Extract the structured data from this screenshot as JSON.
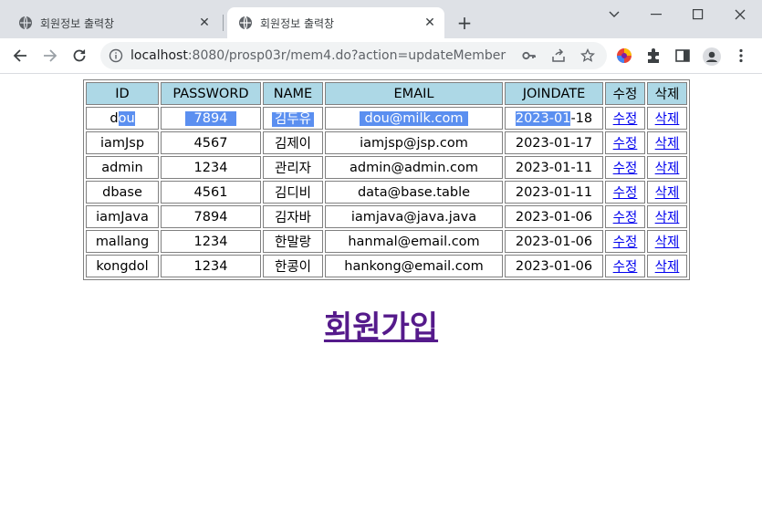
{
  "browser": {
    "tabs": [
      {
        "title": "회원정보 출력창",
        "active": false
      },
      {
        "title": "회원정보 출력창",
        "active": true
      }
    ],
    "url_host": "localhost",
    "url_rest": ":8080/prosp03r/mem4.do?action=updateMember"
  },
  "table": {
    "headers": {
      "id": "ID",
      "password": "PASSWORD",
      "name": "NAME",
      "email": "EMAIL",
      "joindate": "JOINDATE",
      "edit": "수정",
      "delete": "삭제"
    },
    "rows": [
      {
        "id": "dou",
        "password": "7894",
        "name": "김두유",
        "email": "dou@milk.com",
        "joindate": "2023-01-18",
        "edit": "수정",
        "delete": "삭제"
      },
      {
        "id": "iamJsp",
        "password": "4567",
        "name": "김제이",
        "email": "iamjsp@jsp.com",
        "joindate": "2023-01-17",
        "edit": "수정",
        "delete": "삭제"
      },
      {
        "id": "admin",
        "password": "1234",
        "name": "관리자",
        "email": "admin@admin.com",
        "joindate": "2023-01-11",
        "edit": "수정",
        "delete": "삭제"
      },
      {
        "id": "dbase",
        "password": "4561",
        "name": "김디비",
        "email": "data@base.table",
        "joindate": "2023-01-11",
        "edit": "수정",
        "delete": "삭제"
      },
      {
        "id": "iamJava",
        "password": "7894",
        "name": "김자바",
        "email": "iamjava@java.java",
        "joindate": "2023-01-06",
        "edit": "수정",
        "delete": "삭제"
      },
      {
        "id": "mallang",
        "password": "1234",
        "name": "한말랑",
        "email": "hanmal@email.com",
        "joindate": "2023-01-06",
        "edit": "수정",
        "delete": "삭제"
      },
      {
        "id": "kongdol",
        "password": "1234",
        "name": "한콩이",
        "email": "hankong@email.com",
        "joindate": "2023-01-06",
        "edit": "수정",
        "delete": "삭제"
      }
    ],
    "selection_row0": {
      "id_before": "d",
      "id_selected": "ou",
      "date_selected": "2023-01",
      "date_after": "-18"
    }
  },
  "join_link": "회원가입",
  "colors": {
    "header_bg": "#add8e6",
    "selection": "#5b8ff0",
    "link": "#0000ee",
    "visited": "#551a8b"
  }
}
